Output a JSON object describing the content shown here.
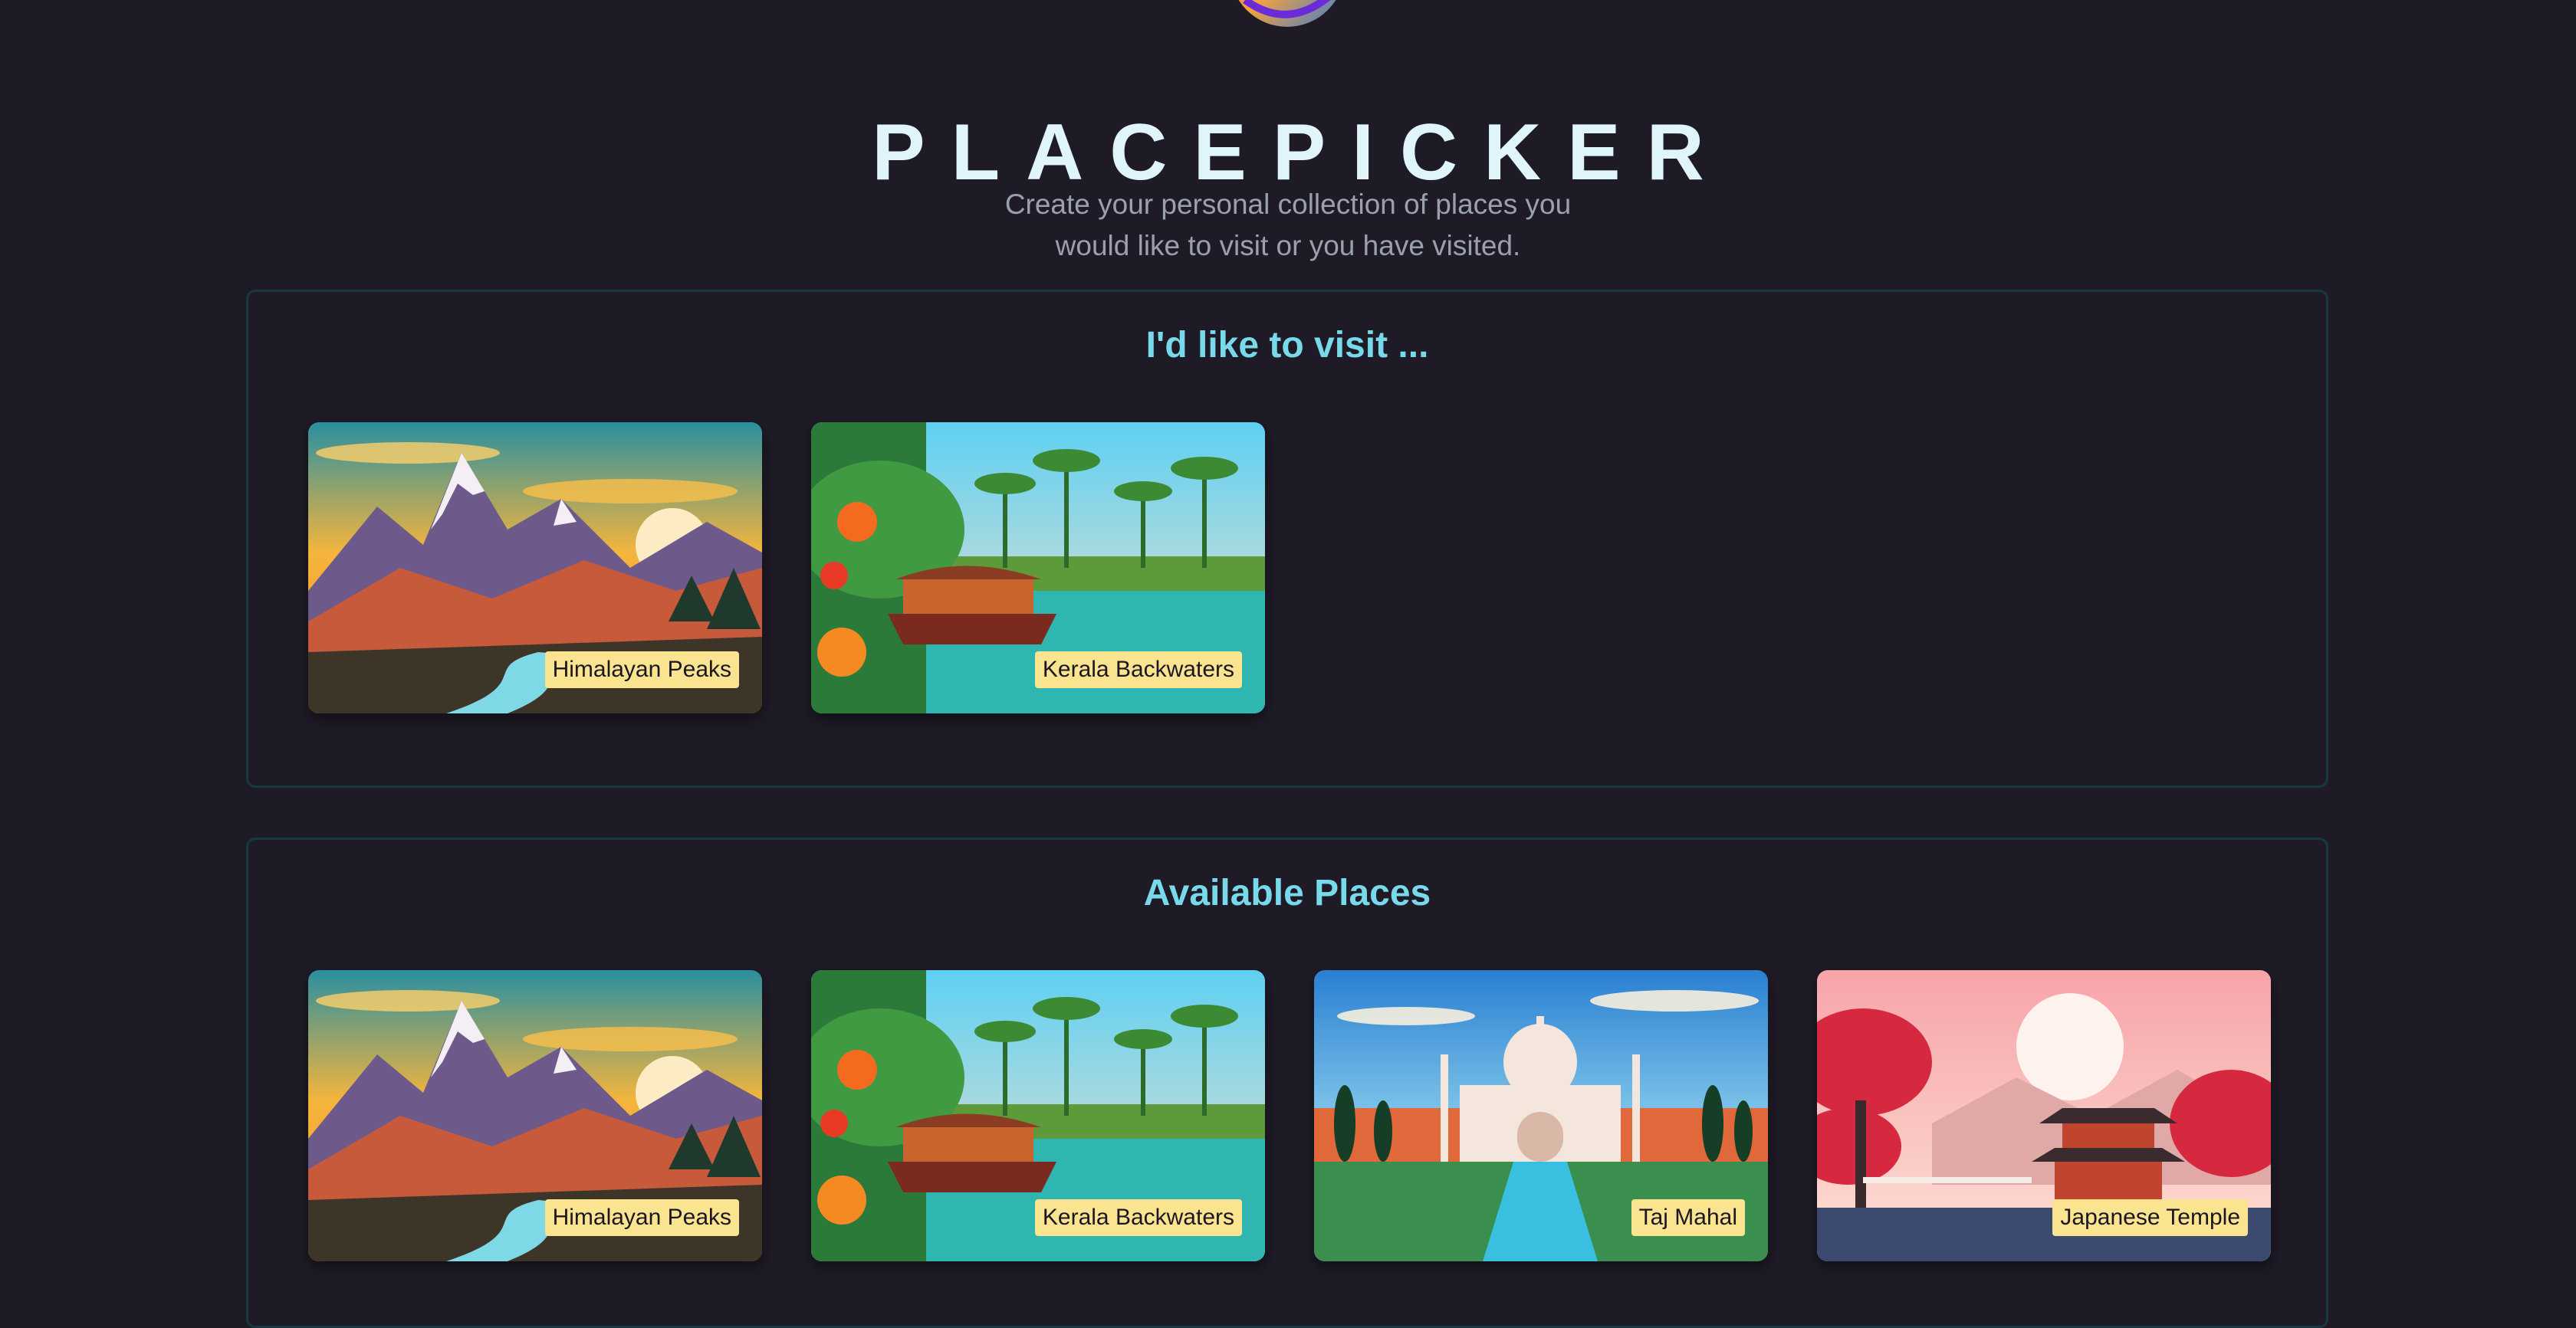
{
  "app": {
    "title": "PLACEPICKER",
    "subtitle": "Create your personal collection of places you would like to visit or you have visited."
  },
  "sections": [
    {
      "title": "I'd like to visit ...",
      "places": [
        {
          "name": "Himalayan Peaks",
          "image": "mountains-illustration"
        },
        {
          "name": "Kerala Backwaters",
          "image": "houseboat-illustration"
        }
      ]
    },
    {
      "title": "Available Places",
      "places": [
        {
          "name": "Himalayan Peaks",
          "image": "mountains-illustration"
        },
        {
          "name": "Kerala Backwaters",
          "image": "houseboat-illustration"
        },
        {
          "name": "Taj Mahal",
          "image": "taj-mahal-illustration"
        },
        {
          "name": "Japanese Temple",
          "image": "pagoda-illustration"
        }
      ]
    }
  ],
  "colors": {
    "background": "#1e1b27",
    "title": "#dff5f9",
    "section_heading": "#78d9ea",
    "section_border": "#143a40",
    "label_background": "#fbe48f"
  }
}
